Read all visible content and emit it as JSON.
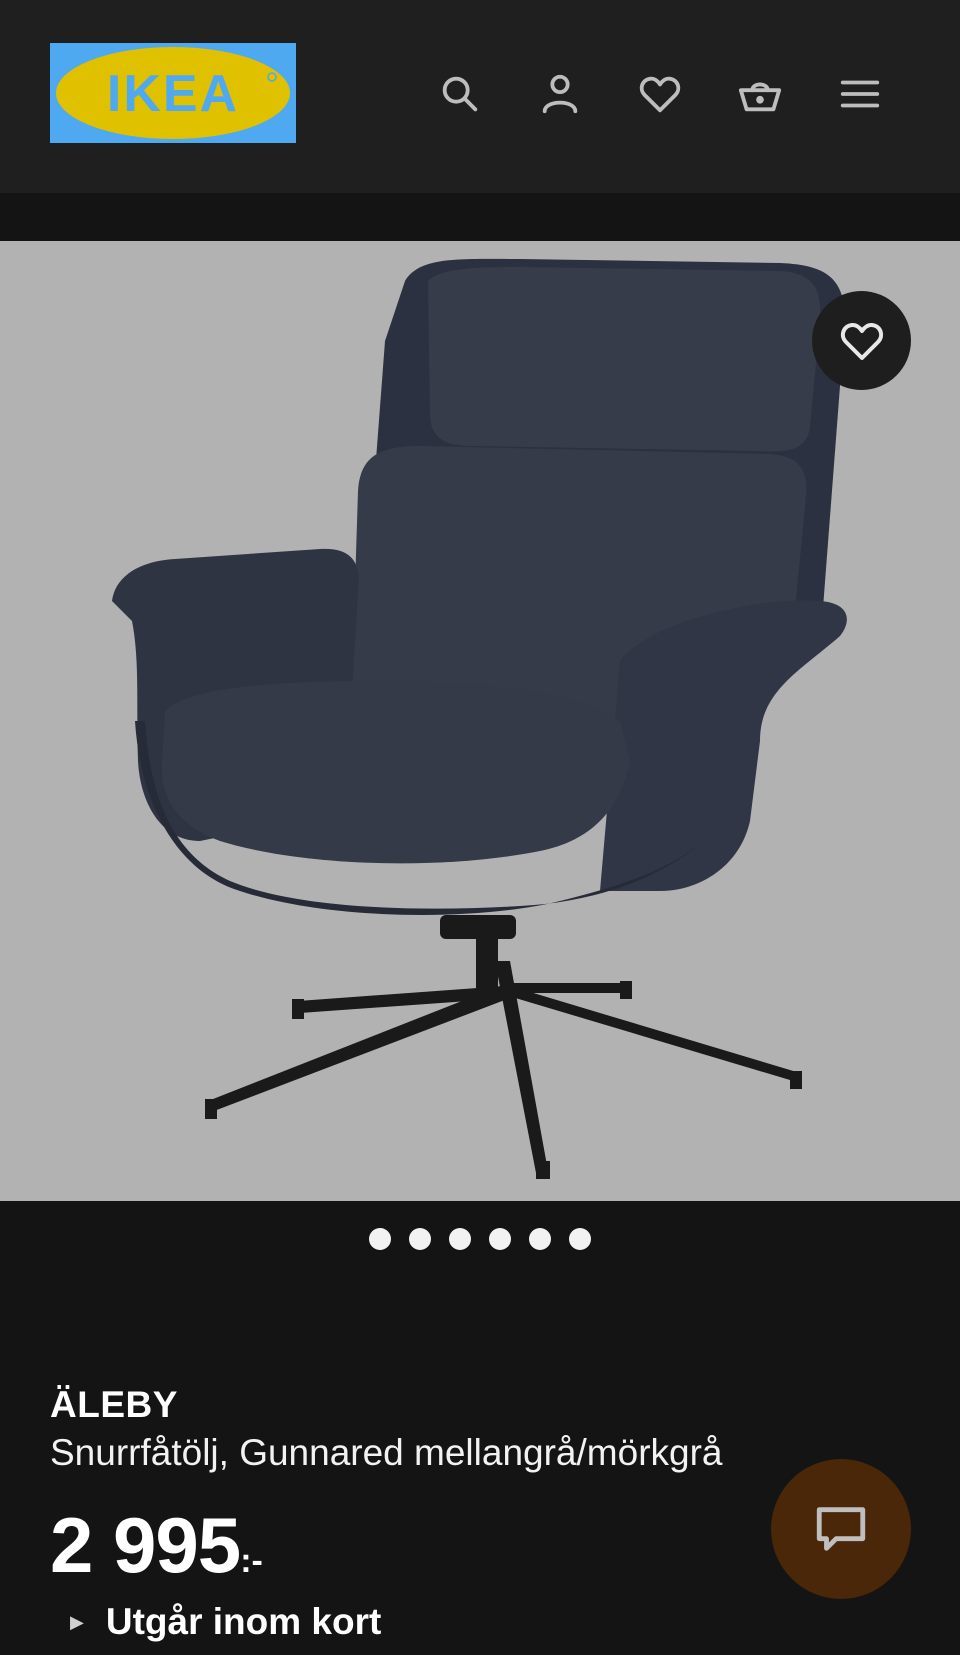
{
  "header": {
    "logo_text": "IKEA",
    "icons": [
      "search-icon",
      "account-icon",
      "heart-icon",
      "basket-icon",
      "menu-icon"
    ]
  },
  "product": {
    "name": "ÄLEBY",
    "description": "Snurrfåtölj, Gunnared mellangrå/mörkgrå",
    "price": "2 995",
    "price_suffix": ":-",
    "status": "Utgår inom kort",
    "image_count": 6
  },
  "colors": {
    "header_bg": "#1f1f1f",
    "page_bg": "#141414",
    "logo_blue": "#4fa9f0",
    "logo_yellow": "#e0c100",
    "chat_button": "#4a2708"
  }
}
